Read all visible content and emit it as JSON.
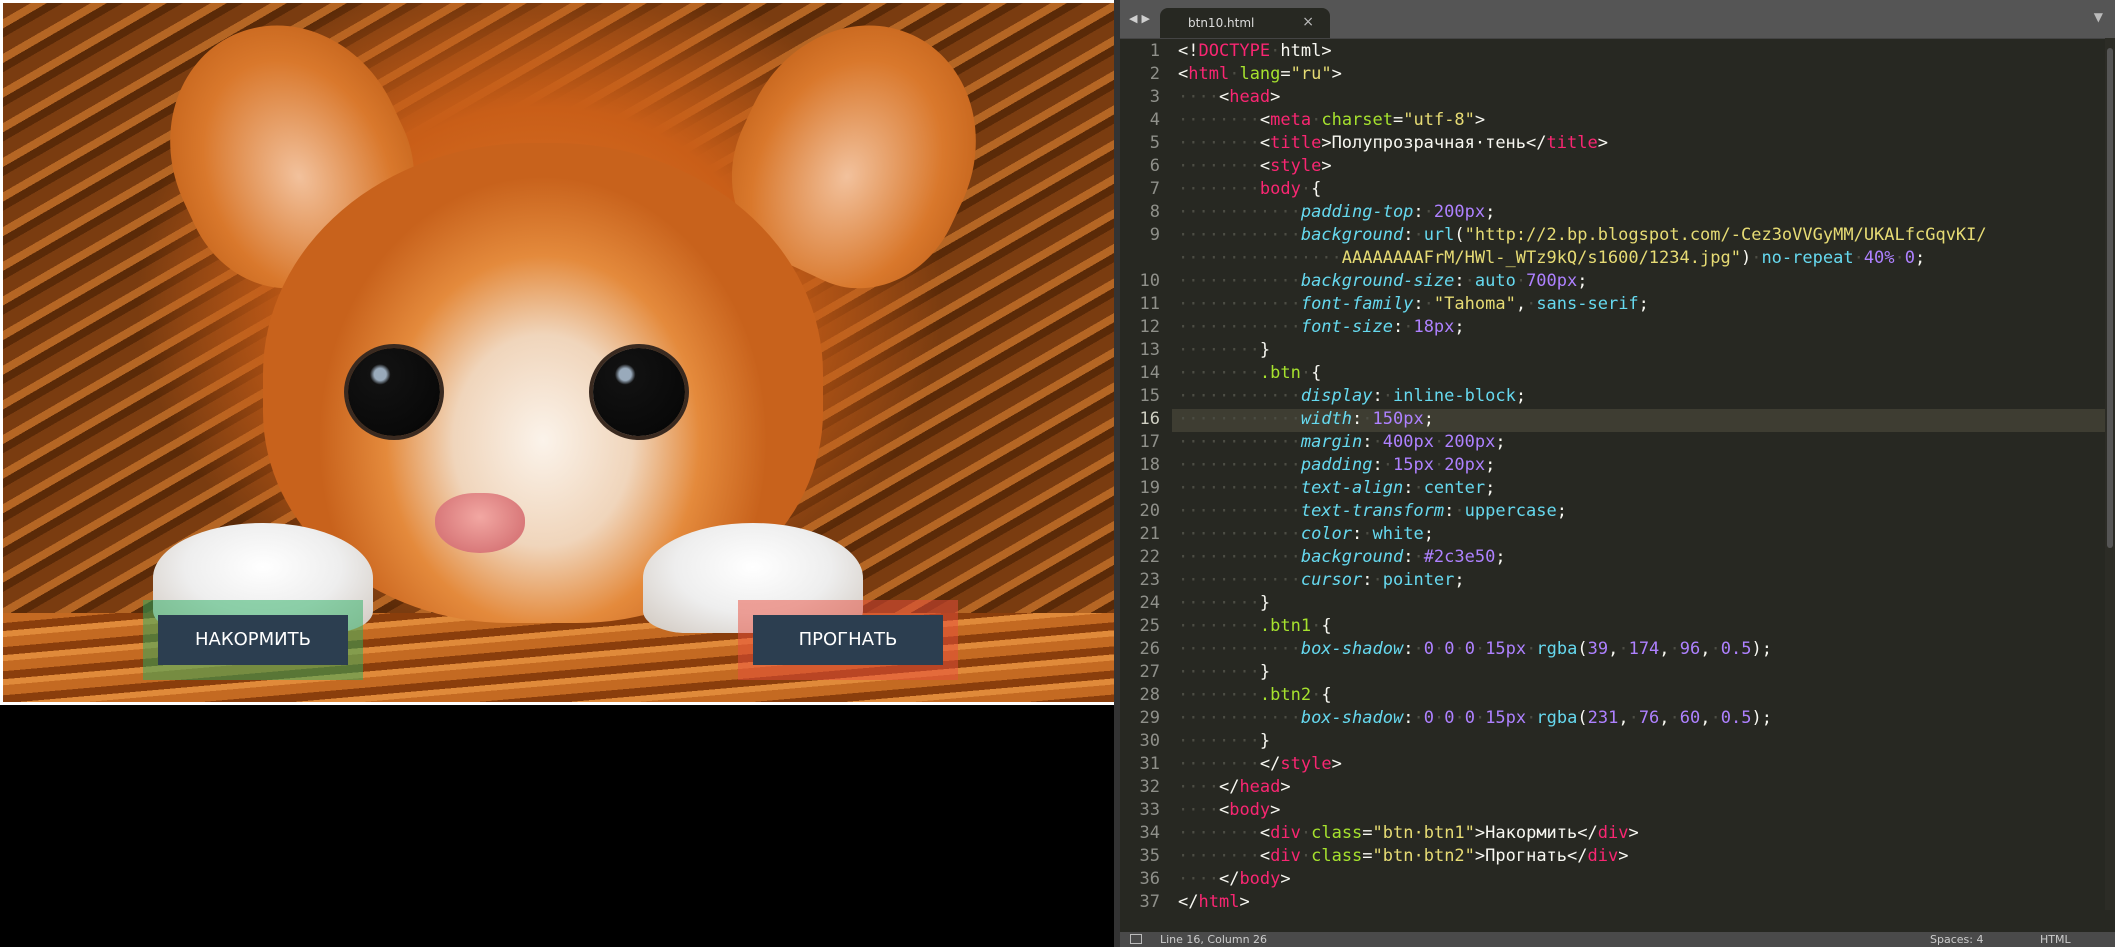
{
  "preview": {
    "buttons": {
      "feed": "Накормить",
      "chase": "Прогнать"
    }
  },
  "editor": {
    "tab": {
      "filename": "btn10.html"
    },
    "current_line": 16,
    "lines": [
      {
        "n": "1"
      },
      {
        "n": "2"
      },
      {
        "n": "3"
      },
      {
        "n": "4"
      },
      {
        "n": "5"
      },
      {
        "n": "6"
      },
      {
        "n": "7"
      },
      {
        "n": "8"
      },
      {
        "n": "9"
      },
      {
        "n": ""
      },
      {
        "n": "10"
      },
      {
        "n": "11"
      },
      {
        "n": "12"
      },
      {
        "n": "13"
      },
      {
        "n": "14"
      },
      {
        "n": "15"
      },
      {
        "n": "16"
      },
      {
        "n": "17"
      },
      {
        "n": "18"
      },
      {
        "n": "19"
      },
      {
        "n": "20"
      },
      {
        "n": "21"
      },
      {
        "n": "22"
      },
      {
        "n": "23"
      },
      {
        "n": "24"
      },
      {
        "n": "25"
      },
      {
        "n": "26"
      },
      {
        "n": "27"
      },
      {
        "n": "28"
      },
      {
        "n": "29"
      },
      {
        "n": "30"
      },
      {
        "n": "31"
      },
      {
        "n": "32"
      },
      {
        "n": "33"
      },
      {
        "n": "34"
      },
      {
        "n": "35"
      },
      {
        "n": "36"
      },
      {
        "n": "37"
      }
    ],
    "code": [
      [
        [
          "p",
          "<!"
        ],
        [
          "tag",
          "DOCTYPE"
        ],
        [
          "ws",
          "·"
        ],
        [
          "p",
          "html>"
        ]
      ],
      [
        [
          "p",
          "<"
        ],
        [
          "tag",
          "html"
        ],
        [
          "ws",
          "·"
        ],
        [
          "attr",
          "lang"
        ],
        [
          "p",
          "="
        ],
        [
          "str",
          "\"ru\""
        ],
        [
          "p",
          ">"
        ]
      ],
      [
        [
          "ws",
          "····"
        ],
        [
          "p",
          "<"
        ],
        [
          "tag",
          "head"
        ],
        [
          "p",
          ">"
        ]
      ],
      [
        [
          "ws",
          "········"
        ],
        [
          "p",
          "<"
        ],
        [
          "tag",
          "meta"
        ],
        [
          "ws",
          "·"
        ],
        [
          "attr",
          "charset"
        ],
        [
          "p",
          "="
        ],
        [
          "str",
          "\"utf-8\""
        ],
        [
          "p",
          ">"
        ]
      ],
      [
        [
          "ws",
          "········"
        ],
        [
          "p",
          "<"
        ],
        [
          "tag",
          "title"
        ],
        [
          "p",
          ">Полупрозрачная·тень</"
        ],
        [
          "tag",
          "title"
        ],
        [
          "p",
          ">"
        ]
      ],
      [
        [
          "ws",
          "········"
        ],
        [
          "p",
          "<"
        ],
        [
          "tag",
          "style"
        ],
        [
          "p",
          ">"
        ]
      ],
      [
        [
          "ws",
          "········"
        ],
        [
          "tag",
          "body"
        ],
        [
          "ws",
          "·"
        ],
        [
          "p",
          "{"
        ]
      ],
      [
        [
          "ws",
          "············"
        ],
        [
          "prop",
          "padding-top"
        ],
        [
          "p",
          ":"
        ],
        [
          "ws",
          "·"
        ],
        [
          "num",
          "200px"
        ],
        [
          "p",
          ";"
        ]
      ],
      [
        [
          "ws",
          "············"
        ],
        [
          "prop",
          "background"
        ],
        [
          "p",
          ":"
        ],
        [
          "ws",
          "·"
        ],
        [
          "kw",
          "url"
        ],
        [
          "p",
          "("
        ],
        [
          "str",
          "\"http://2.bp.blogspot.com/-Cez3oVVGyMM/UKALfcGqvKI/"
        ]
      ],
      [
        [
          "ws",
          "················"
        ],
        [
          "str",
          "AAAAAAAAFrM/HWl-_WTz9kQ/s1600/1234.jpg\""
        ],
        [
          "p",
          ")"
        ],
        [
          "ws",
          "·"
        ],
        [
          "kw",
          "no-repeat"
        ],
        [
          "ws",
          "·"
        ],
        [
          "num",
          "40%"
        ],
        [
          "ws",
          "·"
        ],
        [
          "num",
          "0"
        ],
        [
          "p",
          ";"
        ]
      ],
      [
        [
          "ws",
          "············"
        ],
        [
          "prop",
          "background-size"
        ],
        [
          "p",
          ":"
        ],
        [
          "ws",
          "·"
        ],
        [
          "kw",
          "auto"
        ],
        [
          "ws",
          "·"
        ],
        [
          "num",
          "700px"
        ],
        [
          "p",
          ";"
        ]
      ],
      [
        [
          "ws",
          "············"
        ],
        [
          "prop",
          "font-family"
        ],
        [
          "p",
          ":"
        ],
        [
          "ws",
          "·"
        ],
        [
          "str",
          "\"Tahoma\""
        ],
        [
          "p",
          ","
        ],
        [
          "ws",
          "·"
        ],
        [
          "kw",
          "sans-serif"
        ],
        [
          "p",
          ";"
        ]
      ],
      [
        [
          "ws",
          "············"
        ],
        [
          "prop",
          "font-size"
        ],
        [
          "p",
          ":"
        ],
        [
          "ws",
          "·"
        ],
        [
          "num",
          "18px"
        ],
        [
          "p",
          ";"
        ]
      ],
      [
        [
          "ws",
          "········"
        ],
        [
          "p",
          "}"
        ]
      ],
      [
        [
          "ws",
          "········"
        ],
        [
          "sel",
          ".btn"
        ],
        [
          "ws",
          "·"
        ],
        [
          "p",
          "{"
        ]
      ],
      [
        [
          "ws",
          "············"
        ],
        [
          "prop",
          "display"
        ],
        [
          "p",
          ":"
        ],
        [
          "ws",
          "·"
        ],
        [
          "kw",
          "inline-block"
        ],
        [
          "p",
          ";"
        ]
      ],
      [
        [
          "ws",
          "············"
        ],
        [
          "prop",
          "width"
        ],
        [
          "p",
          ":"
        ],
        [
          "ws",
          "·"
        ],
        [
          "num",
          "150px"
        ],
        [
          "p",
          ";"
        ]
      ],
      [
        [
          "ws",
          "············"
        ],
        [
          "prop",
          "margin"
        ],
        [
          "p",
          ":"
        ],
        [
          "ws",
          "·"
        ],
        [
          "num",
          "400px"
        ],
        [
          "ws",
          "·"
        ],
        [
          "num",
          "200px"
        ],
        [
          "p",
          ";"
        ]
      ],
      [
        [
          "ws",
          "············"
        ],
        [
          "prop",
          "padding"
        ],
        [
          "p",
          ":"
        ],
        [
          "ws",
          "·"
        ],
        [
          "num",
          "15px"
        ],
        [
          "ws",
          "·"
        ],
        [
          "num",
          "20px"
        ],
        [
          "p",
          ";"
        ]
      ],
      [
        [
          "ws",
          "············"
        ],
        [
          "prop",
          "text-align"
        ],
        [
          "p",
          ":"
        ],
        [
          "ws",
          "·"
        ],
        [
          "kw",
          "center"
        ],
        [
          "p",
          ";"
        ]
      ],
      [
        [
          "ws",
          "············"
        ],
        [
          "prop",
          "text-transform"
        ],
        [
          "p",
          ":"
        ],
        [
          "ws",
          "·"
        ],
        [
          "kw",
          "uppercase"
        ],
        [
          "p",
          ";"
        ]
      ],
      [
        [
          "ws",
          "············"
        ],
        [
          "prop",
          "color"
        ],
        [
          "p",
          ":"
        ],
        [
          "ws",
          "·"
        ],
        [
          "kw",
          "white"
        ],
        [
          "p",
          ";"
        ]
      ],
      [
        [
          "ws",
          "············"
        ],
        [
          "prop",
          "background"
        ],
        [
          "p",
          ":"
        ],
        [
          "ws",
          "·"
        ],
        [
          "num",
          "#2c3e50"
        ],
        [
          "p",
          ";"
        ]
      ],
      [
        [
          "ws",
          "············"
        ],
        [
          "prop",
          "cursor"
        ],
        [
          "p",
          ":"
        ],
        [
          "ws",
          "·"
        ],
        [
          "kw",
          "pointer"
        ],
        [
          "p",
          ";"
        ]
      ],
      [
        [
          "ws",
          "········"
        ],
        [
          "p",
          "}"
        ]
      ],
      [
        [
          "ws",
          "········"
        ],
        [
          "sel",
          ".btn1"
        ],
        [
          "ws",
          "·"
        ],
        [
          "p",
          "{"
        ]
      ],
      [
        [
          "ws",
          "············"
        ],
        [
          "prop",
          "box-shadow"
        ],
        [
          "p",
          ":"
        ],
        [
          "ws",
          "·"
        ],
        [
          "num",
          "0"
        ],
        [
          "ws",
          "·"
        ],
        [
          "num",
          "0"
        ],
        [
          "ws",
          "·"
        ],
        [
          "num",
          "0"
        ],
        [
          "ws",
          "·"
        ],
        [
          "num",
          "15px"
        ],
        [
          "ws",
          "·"
        ],
        [
          "kw",
          "rgba"
        ],
        [
          "p",
          "("
        ],
        [
          "num",
          "39"
        ],
        [
          "p",
          ","
        ],
        [
          "ws",
          "·"
        ],
        [
          "num",
          "174"
        ],
        [
          "p",
          ","
        ],
        [
          "ws",
          "·"
        ],
        [
          "num",
          "96"
        ],
        [
          "p",
          ","
        ],
        [
          "ws",
          "·"
        ],
        [
          "num",
          "0.5"
        ],
        [
          "p",
          ");"
        ]
      ],
      [
        [
          "ws",
          "········"
        ],
        [
          "p",
          "}"
        ]
      ],
      [
        [
          "ws",
          "········"
        ],
        [
          "sel",
          ".btn2"
        ],
        [
          "ws",
          "·"
        ],
        [
          "p",
          "{"
        ]
      ],
      [
        [
          "ws",
          "············"
        ],
        [
          "prop",
          "box-shadow"
        ],
        [
          "p",
          ":"
        ],
        [
          "ws",
          "·"
        ],
        [
          "num",
          "0"
        ],
        [
          "ws",
          "·"
        ],
        [
          "num",
          "0"
        ],
        [
          "ws",
          "·"
        ],
        [
          "num",
          "0"
        ],
        [
          "ws",
          "·"
        ],
        [
          "num",
          "15px"
        ],
        [
          "ws",
          "·"
        ],
        [
          "kw",
          "rgba"
        ],
        [
          "p",
          "("
        ],
        [
          "num",
          "231"
        ],
        [
          "p",
          ","
        ],
        [
          "ws",
          "·"
        ],
        [
          "num",
          "76"
        ],
        [
          "p",
          ","
        ],
        [
          "ws",
          "·"
        ],
        [
          "num",
          "60"
        ],
        [
          "p",
          ","
        ],
        [
          "ws",
          "·"
        ],
        [
          "num",
          "0.5"
        ],
        [
          "p",
          ");"
        ]
      ],
      [
        [
          "ws",
          "········"
        ],
        [
          "p",
          "}"
        ]
      ],
      [
        [
          "ws",
          "········"
        ],
        [
          "p",
          "</"
        ],
        [
          "tag",
          "style"
        ],
        [
          "p",
          ">"
        ]
      ],
      [
        [
          "ws",
          "····"
        ],
        [
          "p",
          "</"
        ],
        [
          "tag",
          "head"
        ],
        [
          "p",
          ">"
        ]
      ],
      [
        [
          "ws",
          "····"
        ],
        [
          "p",
          "<"
        ],
        [
          "tag",
          "body"
        ],
        [
          "p",
          ">"
        ]
      ],
      [
        [
          "ws",
          "········"
        ],
        [
          "p",
          "<"
        ],
        [
          "tag",
          "div"
        ],
        [
          "ws",
          "·"
        ],
        [
          "attr",
          "class"
        ],
        [
          "p",
          "="
        ],
        [
          "str",
          "\"btn·btn1\""
        ],
        [
          "p",
          ">Накормить</"
        ],
        [
          "tag",
          "div"
        ],
        [
          "p",
          ">"
        ]
      ],
      [
        [
          "ws",
          "········"
        ],
        [
          "p",
          "<"
        ],
        [
          "tag",
          "div"
        ],
        [
          "ws",
          "·"
        ],
        [
          "attr",
          "class"
        ],
        [
          "p",
          "="
        ],
        [
          "str",
          "\"btn·btn2\""
        ],
        [
          "p",
          ">Прогнать</"
        ],
        [
          "tag",
          "div"
        ],
        [
          "p",
          ">"
        ]
      ],
      [
        [
          "ws",
          "····"
        ],
        [
          "p",
          "</"
        ],
        [
          "tag",
          "body"
        ],
        [
          "p",
          ">"
        ]
      ],
      [
        [
          "p",
          "</"
        ],
        [
          "tag",
          "html"
        ],
        [
          "p",
          ">"
        ]
      ]
    ]
  },
  "status": {
    "position": "Line 16, Column 26",
    "spaces": "Spaces: 4",
    "syntax": "HTML"
  },
  "colors": {
    "btn_bg": "#2c3e50",
    "btn1_glow": "rgba(39,174,96,0.5)",
    "btn2_glow": "rgba(231,76,60,0.5)",
    "editor_bg": "#272822"
  }
}
